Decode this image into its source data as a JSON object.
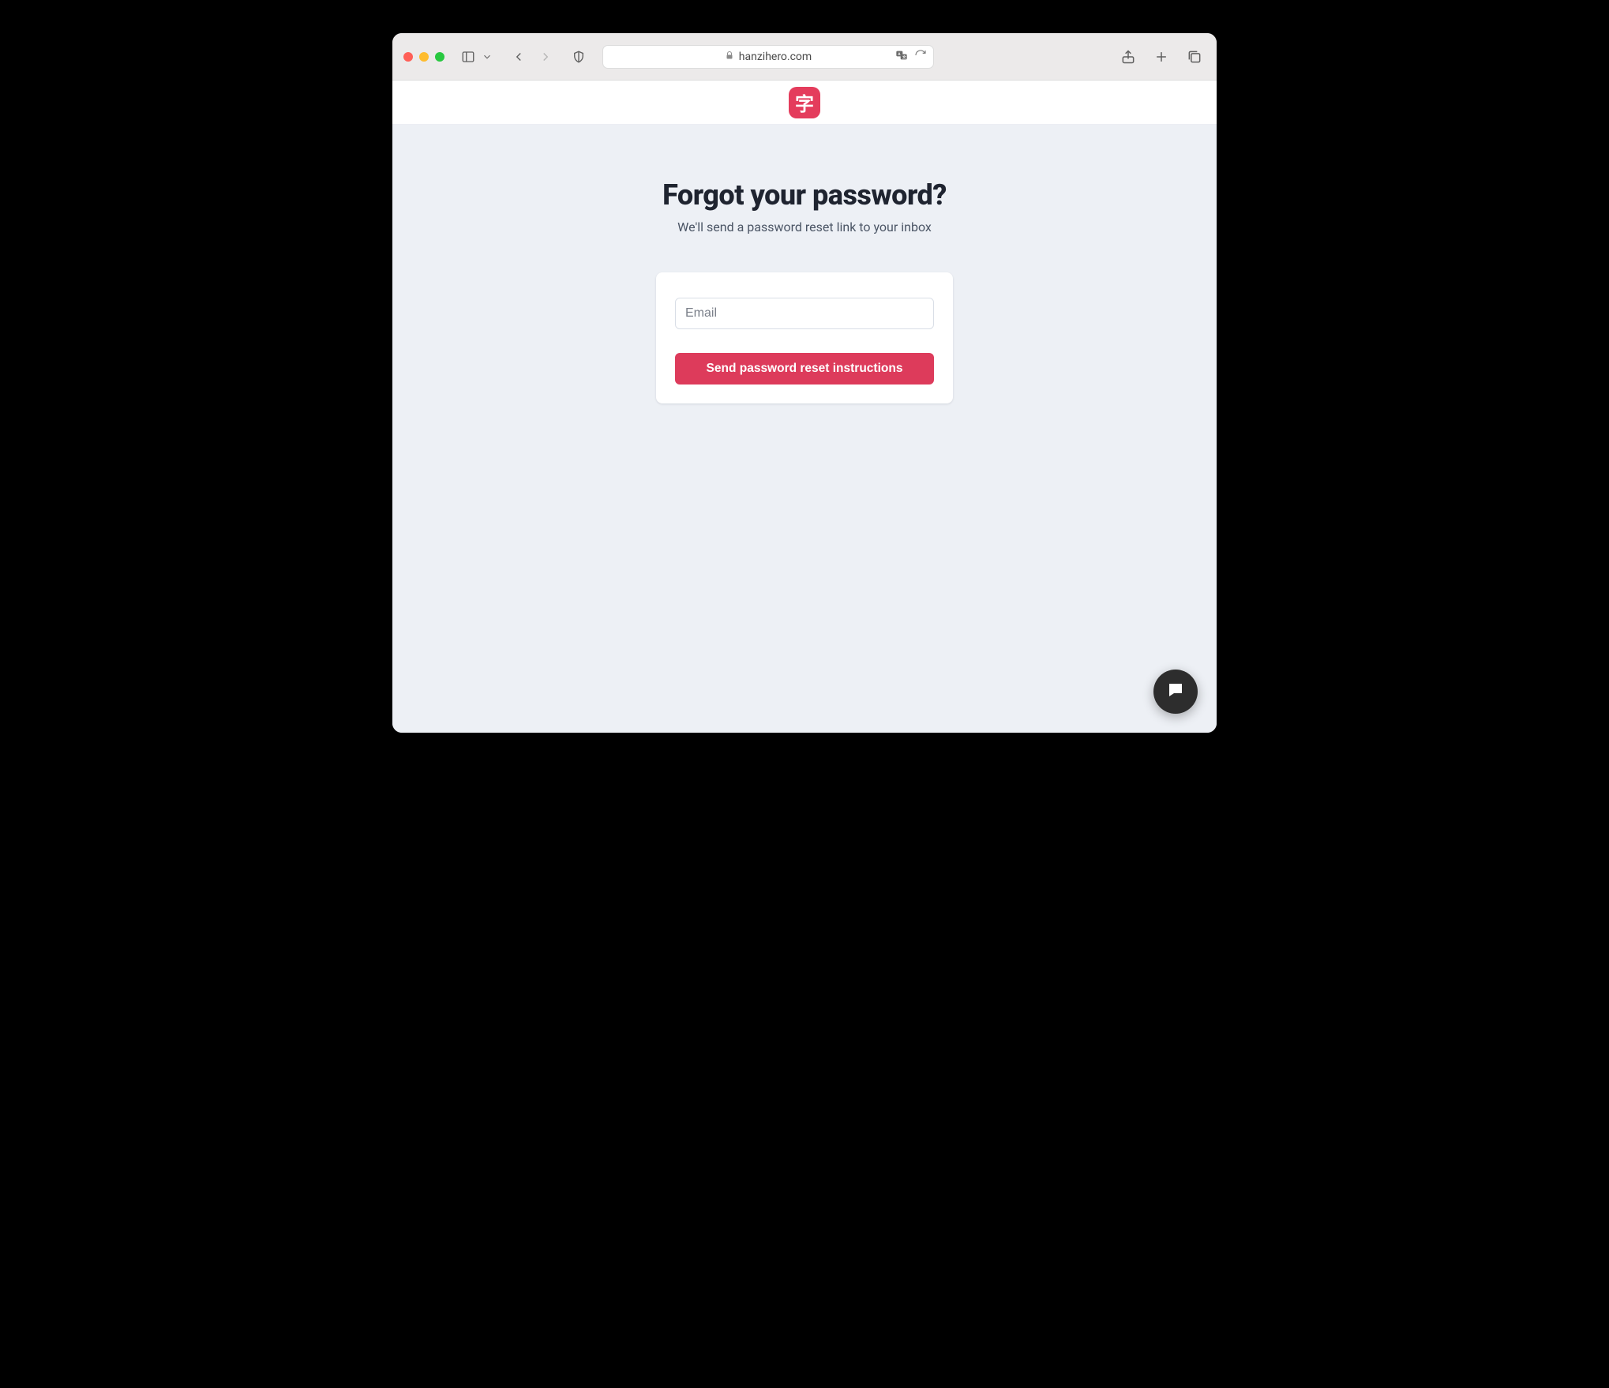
{
  "browser": {
    "url_display": "hanzihero.com"
  },
  "header": {
    "logo_glyph": "字"
  },
  "main": {
    "title": "Forgot your password?",
    "subtitle": "We'll send a password reset link to your inbox",
    "email_placeholder": "Email",
    "submit_label": "Send password reset instructions"
  },
  "colors": {
    "brand": "#e43c5c",
    "page_bg": "#edf0f5"
  }
}
